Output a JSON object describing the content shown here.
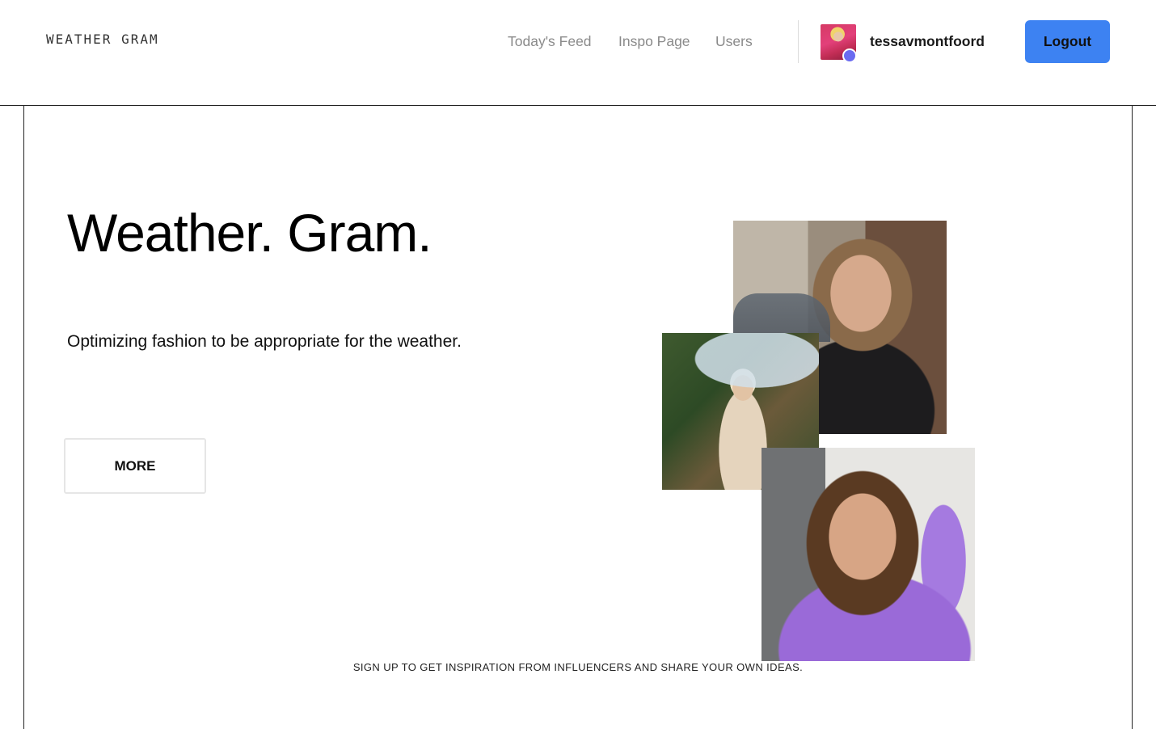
{
  "app": {
    "logo": "WEATHER GRAM"
  },
  "nav": {
    "items": [
      {
        "label": "Today's Feed"
      },
      {
        "label": "Inspo Page"
      },
      {
        "label": "Users"
      }
    ]
  },
  "user": {
    "username": "tessavmontfoord",
    "status_color": "#6a6bf0"
  },
  "actions": {
    "logout_label": "Logout",
    "logout_color": "#3d82f2"
  },
  "hero": {
    "title": "Weather. Gram.",
    "subtitle": "Optimizing fashion to be appropriate for the weather.",
    "more_label": "MORE"
  },
  "footer": {
    "tagline": "SIGN UP TO GET INSPIRATION FROM INFLUENCERS AND SHARE YOUR OWN IDEAS."
  }
}
